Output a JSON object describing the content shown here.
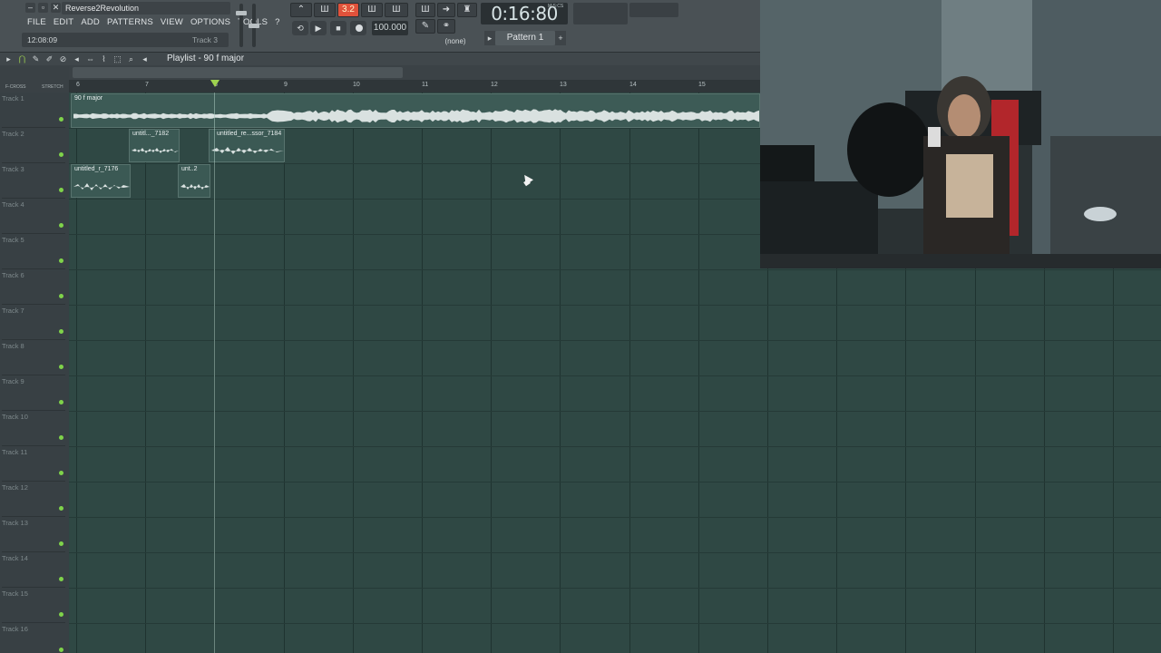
{
  "window": {
    "title": "Reverse2Revolution",
    "controls": [
      "–",
      "▫",
      "✕"
    ]
  },
  "menu": [
    "FILE",
    "EDIT",
    "ADD",
    "PATTERNS",
    "VIEW",
    "OPTIONS",
    "TOOLS",
    "?"
  ],
  "hint_bar": {
    "time": "12:08:09",
    "track": "Track 3"
  },
  "transport": {
    "pattern_song_label": "3.2",
    "tempo": "100.000",
    "time": "0:16:80",
    "time_units": "M:S:CS",
    "pattern": "Pattern 1",
    "snap": "(none)"
  },
  "playlist": {
    "title": "Playlist - 90 f major",
    "ruler_left": [
      "F-CROSS",
      "STRETCH"
    ],
    "ticks": [
      "6",
      "7",
      "8",
      "9",
      "10",
      "11",
      "12",
      "13",
      "14",
      "15"
    ]
  },
  "tracks": [
    "Track 1",
    "Track 2",
    "Track 3",
    "Track 4",
    "Track 5",
    "Track 6",
    "Track 7",
    "Track 8",
    "Track 9",
    "Track 10",
    "Track 11",
    "Track 12",
    "Track 13",
    "Track 14",
    "Track 15",
    "Track 16"
  ],
  "clips": {
    "c1": "90 f major",
    "c2": "untitl..._7182",
    "c3": "untitled_re...ssor_7184",
    "c4": "untitled_r_7176",
    "c5": "unt..2"
  },
  "colors": {
    "accent_active": "#e0523b",
    "grid_bg": "#2f4844",
    "track_led": "#7fd34a",
    "playhead": "#9fd34f"
  }
}
